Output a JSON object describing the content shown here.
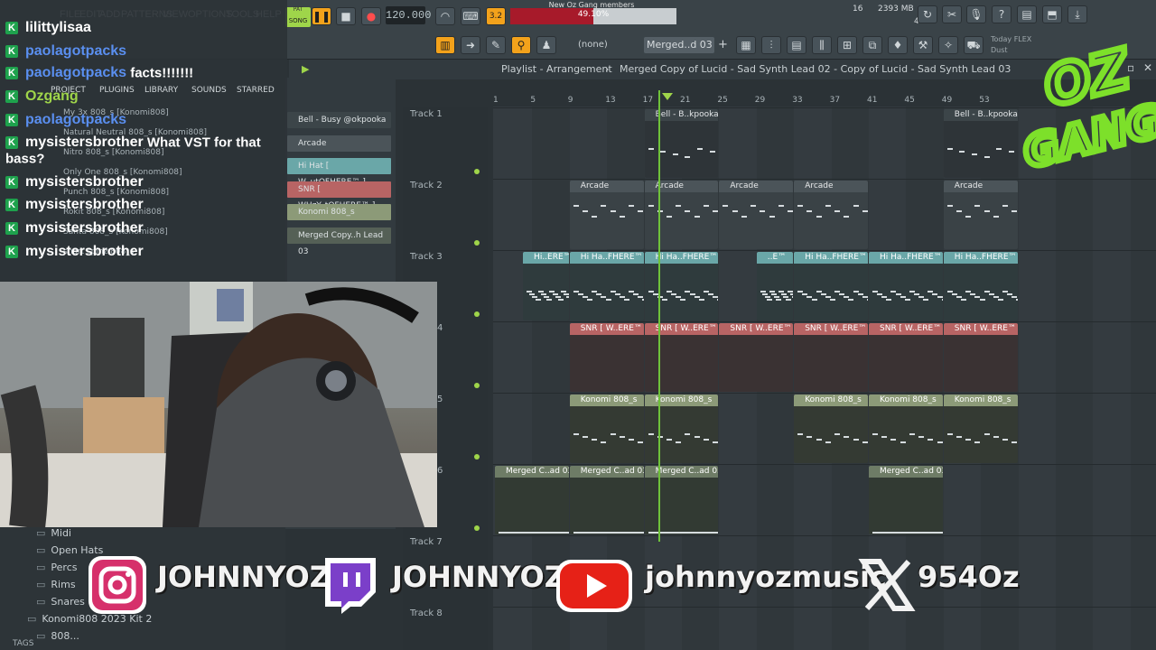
{
  "menu": [
    "FILE",
    "EDIT",
    "ADD",
    "PATTERNS",
    "VIEW",
    "OPTIONS",
    "TOOLS",
    "HELP"
  ],
  "transport": {
    "mode_pat": "PAT",
    "mode_song": "SONG",
    "tempo": "120.000",
    "step": "3.2"
  },
  "cpu": {
    "label": "New Oz Gang members",
    "text": "49.10%",
    "ratio": 0.5
  },
  "memory": {
    "mb": "2393 MB",
    "poly": "16",
    "voices": "4"
  },
  "pattern": {
    "none_label": "(none)",
    "current": "Merged..d 03"
  },
  "today": {
    "line1": "Today",
    "flex": "FLEX",
    "line2": "Dust"
  },
  "chat": [
    {
      "user": "lilittylisaa",
      "color": "#ffffff",
      "msg": ""
    },
    {
      "user": "paolagotpacks",
      "color": "#5a8ff0",
      "msg": ""
    },
    {
      "user": "paolagotpacks",
      "color": "#5a8ff0",
      "msg": "facts!!!!!!!"
    },
    {
      "user": "Ozgang",
      "color": "#9fd54a",
      "msg": ""
    },
    {
      "user": "paolagotpacks",
      "color": "#5a8ff0",
      "msg": ""
    },
    {
      "user": "mysistersbrother",
      "color": "#ffffff",
      "msg": "What VST for that bass?"
    },
    {
      "user": "mysistersbrother",
      "color": "#ffffff",
      "msg": ""
    },
    {
      "user": "mysistersbrother",
      "color": "#ffffff",
      "msg": ""
    },
    {
      "user": "mysistersbrother",
      "color": "#ffffff",
      "msg": ""
    },
    {
      "user": "mysistersbrother",
      "color": "#ffffff",
      "msg": ""
    }
  ],
  "browser_tabs": [
    "PROJECT",
    "PLUGINS",
    "LIBRARY",
    "SOUNDS",
    "STARRED"
  ],
  "browser_files": [
    "My 3x 808_s [Konomi808]",
    "Natural Neutral 808_s [Konomi808]",
    "Nitro 808_s [Konomi808]",
    "Only One 808_s [Konomi808]",
    "Punch 808_s [Konomi808]",
    "Rokit 808_s [Konomi808]",
    "Santa 808_s [Konomi808]",
    "short spinz 808_s"
  ],
  "channels": [
    {
      "name": "Bell - Busy @okpooka",
      "color": "#3c4549"
    },
    {
      "name": "Arcade",
      "color": "#4b5459"
    },
    {
      "name": "Hi Hat [ W..utOFHERE™ ]",
      "color": "#6aa7a8"
    },
    {
      "name": "SNR [ WHzY..tOFHERE™ ]",
      "color": "#b86464"
    },
    {
      "name": "Konomi 808_s",
      "color": "#8c9a78"
    },
    {
      "name": "Merged Copy..h Lead 03",
      "color": "#556056"
    }
  ],
  "playlist": {
    "title": "Playlist - Arrangement",
    "breadcrumb": "Merged Copy of Lucid - Sad Synth Lead 02 - Copy of Lucid - Sad Synth Lead 03",
    "ruler": [
      "1",
      "5",
      "9",
      "13",
      "17",
      "21",
      "25",
      "29",
      "33",
      "37",
      "41",
      "45",
      "49",
      "53"
    ],
    "tracks": [
      "Track 1",
      "Track 2",
      "Track 3",
      "4",
      "5",
      "6",
      "Track 7",
      "Track 8"
    ],
    "clips": [
      {
        "type": "bell",
        "lane": 0,
        "start": 17,
        "len": 8,
        "label": "Bell - B..kpooka"
      },
      {
        "type": "bell",
        "lane": 0,
        "start": 49,
        "len": 8,
        "label": "Bell - B..kpooka"
      },
      {
        "type": "arcade",
        "lane": 1,
        "start": 9,
        "len": 8,
        "label": "Arcade"
      },
      {
        "type": "arcade",
        "lane": 1,
        "start": 17,
        "len": 8,
        "label": "Arcade"
      },
      {
        "type": "arcade",
        "lane": 1,
        "start": 25,
        "len": 8,
        "label": "Arcade"
      },
      {
        "type": "arcade",
        "lane": 1,
        "start": 33,
        "len": 8,
        "label": "Arcade"
      },
      {
        "type": "arcade",
        "lane": 1,
        "start": 49,
        "len": 8,
        "label": "Arcade"
      },
      {
        "type": "hihat",
        "lane": 2,
        "start": 4,
        "len": 5,
        "label": "Hi..ERE™"
      },
      {
        "type": "hihat",
        "lane": 2,
        "start": 9,
        "len": 8,
        "label": "Hi Ha..FHERE™"
      },
      {
        "type": "hihat",
        "lane": 2,
        "start": 17,
        "len": 8,
        "label": "Hi Ha..FHERE™"
      },
      {
        "type": "hihat",
        "lane": 2,
        "start": 29,
        "len": 4,
        "label": "..E™"
      },
      {
        "type": "hihat",
        "lane": 2,
        "start": 33,
        "len": 8,
        "label": "Hi Ha..FHERE™"
      },
      {
        "type": "hihat",
        "lane": 2,
        "start": 41,
        "len": 8,
        "label": "Hi Ha..FHERE™"
      },
      {
        "type": "hihat",
        "lane": 2,
        "start": 49,
        "len": 8,
        "label": "Hi Ha..FHERE™"
      },
      {
        "type": "snr",
        "lane": 3,
        "start": 9,
        "len": 8,
        "label": "SNR [ W..ERE™"
      },
      {
        "type": "snr",
        "lane": 3,
        "start": 17,
        "len": 8,
        "label": "SNR [ W..ERE™"
      },
      {
        "type": "snr",
        "lane": 3,
        "start": 25,
        "len": 8,
        "label": "SNR [ W..ERE™"
      },
      {
        "type": "snr",
        "lane": 3,
        "start": 33,
        "len": 8,
        "label": "SNR [ W..ERE™"
      },
      {
        "type": "snr",
        "lane": 3,
        "start": 41,
        "len": 8,
        "label": "SNR [ W..ERE™"
      },
      {
        "type": "snr",
        "lane": 3,
        "start": 49,
        "len": 8,
        "label": "SNR [ W..ERE™"
      },
      {
        "type": "konomi",
        "lane": 4,
        "start": 9,
        "len": 8,
        "label": "Konomi 808_s"
      },
      {
        "type": "konomi",
        "lane": 4,
        "start": 17,
        "len": 8,
        "label": "Konomi 808_s"
      },
      {
        "type": "konomi",
        "lane": 4,
        "start": 33,
        "len": 8,
        "label": "Konomi 808_s"
      },
      {
        "type": "konomi",
        "lane": 4,
        "start": 41,
        "len": 8,
        "label": "Konomi 808_s"
      },
      {
        "type": "konomi",
        "lane": 4,
        "start": 49,
        "len": 8,
        "label": "Konomi 808_s"
      },
      {
        "type": "merged",
        "lane": 5,
        "start": 1,
        "len": 8,
        "label": "Merged C..ad 03"
      },
      {
        "type": "merged",
        "lane": 5,
        "start": 9,
        "len": 8,
        "label": "Merged C..ad 03"
      },
      {
        "type": "merged",
        "lane": 5,
        "start": 17,
        "len": 8,
        "label": "Merged C..ad 03"
      },
      {
        "type": "merged",
        "lane": 5,
        "start": 41,
        "len": 8,
        "label": "Merged C..ad 03"
      }
    ],
    "playhead_bar": 18
  },
  "folders": [
    "Midi",
    "Open Hats",
    "Percs",
    "Rims",
    "Snares",
    "Konomi808 2023 Kit 2",
    "808..."
  ],
  "tags_label": "TAGS",
  "socials": [
    {
      "icon": "instagram-icon",
      "handle": "JOHNNYOZ"
    },
    {
      "icon": "twitch-icon",
      "handle": "JOHNNYOZ"
    },
    {
      "icon": "youtube-icon",
      "handle": "johnnyozmusic"
    },
    {
      "icon": "x-icon",
      "handle": "954Oz"
    }
  ],
  "logo": {
    "line1": "OZ",
    "line2": "GANG",
    "color": "#7de02a"
  }
}
